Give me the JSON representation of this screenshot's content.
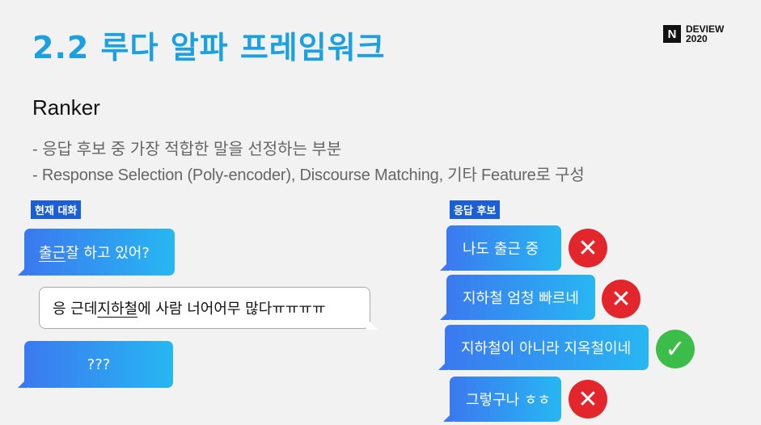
{
  "title": "2.2 루다 알파 프레임워크",
  "logo": {
    "mark": "N",
    "line1": "DEVIEW",
    "line2": "2020"
  },
  "subtitle": "Ranker",
  "bullets": [
    "- 응답 후보 중 가장 적합한 말을 선정하는 부분",
    "- Response Selection (Poly-encoder), Discourse Matching, 기타 Feature로 구성"
  ],
  "conversation": {
    "tag": "현재 대화",
    "msg1": {
      "underlined": "출근",
      "rest": " 잘 하고 있어?"
    },
    "reply": {
      "pre": "응 근데 ",
      "underlined": "지하철",
      "post": "에 사람 너어어무 많다ㅠㅠㅠㅠ"
    },
    "msg3": "???"
  },
  "candidates": {
    "tag": "응답 후보",
    "items": [
      {
        "text": "나도 출근 중",
        "result": "x"
      },
      {
        "text": "지하철 엄청 빠르네",
        "result": "x"
      },
      {
        "text": "지하철이 아니라 지옥철이네",
        "result": "check"
      },
      {
        "text": "그렇구나 ㅎㅎ",
        "result": "x"
      }
    ],
    "x_symbol": "✕",
    "check_symbol": "✓"
  },
  "colors": {
    "title": "#1ba0e2",
    "tag": "#1a5fd6",
    "reject": "#e3262b",
    "accept": "#3cbd4a"
  }
}
